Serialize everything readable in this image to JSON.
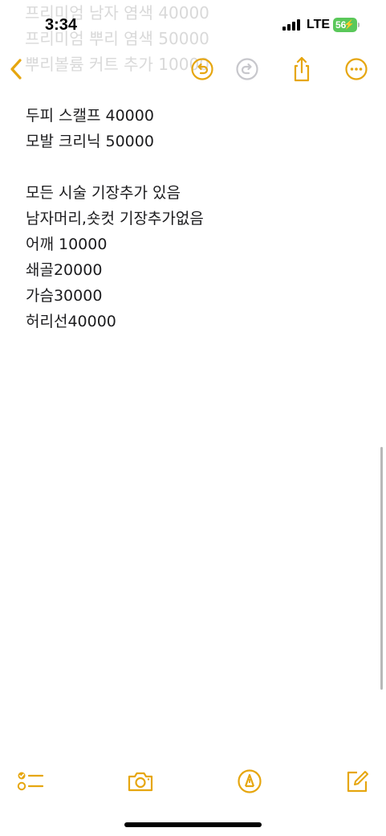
{
  "status_bar": {
    "time": "3:34",
    "network": "LTE",
    "battery_percent": "56"
  },
  "ghost_lines": [
    "프리미엄 남자 염색 40000",
    "프리미엄 뿌리 염색 50000",
    "뿌리볼륨 커트 추가 10000"
  ],
  "note_lines": [
    "두피 스캘프 40000",
    "모발 크리닉 50000",
    "",
    "모든 시술 기장추가 있음",
    "남자머리,숏컷 기장추가없음",
    "어깨 10000",
    "쇄골20000",
    "가슴30000",
    "허리선40000"
  ],
  "colors": {
    "accent": "#e6a60f",
    "disabled": "#c7c7cc",
    "text": "#1c1c1e",
    "battery": "#5ac85a"
  },
  "icons": {
    "nav": [
      "chevron-left-icon",
      "undo-icon",
      "redo-icon",
      "share-icon",
      "more-icon"
    ],
    "toolbar": [
      "checklist-icon",
      "camera-icon",
      "markup-icon",
      "compose-icon"
    ]
  }
}
